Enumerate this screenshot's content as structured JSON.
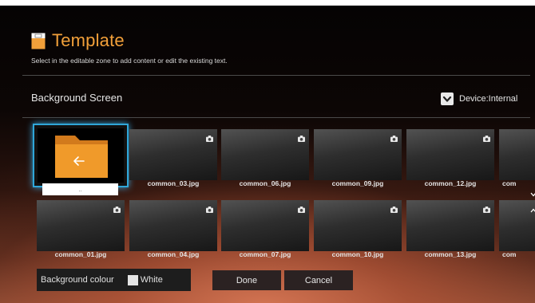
{
  "header": {
    "title": "Template",
    "subtitle": "Select in the editable zone to add content or edit the existing text."
  },
  "section": {
    "title": "Background Screen",
    "device_label": "Device:Internal"
  },
  "folder_item": {
    "label": ".."
  },
  "row1": [
    "common_03.jpg",
    "common_06.jpg",
    "common_09.jpg",
    "common_12.jpg",
    "com"
  ],
  "row2": [
    "common_01.jpg",
    "common_04.jpg",
    "common_07.jpg",
    "common_10.jpg",
    "common_13.jpg",
    "com"
  ],
  "footer": {
    "bg_colour_label": "Background colour",
    "bg_colour_value": "White",
    "done_label": "Done",
    "cancel_label": "Cancel"
  },
  "colors": {
    "accent": "#f2a03a",
    "selection": "#2fa6d8",
    "folder": "#f09a2a"
  },
  "icons": {
    "template": "document-icon",
    "device": "checkbox-icon",
    "thumb_badge": "camera-icon",
    "folder": "folder-back-icon"
  }
}
